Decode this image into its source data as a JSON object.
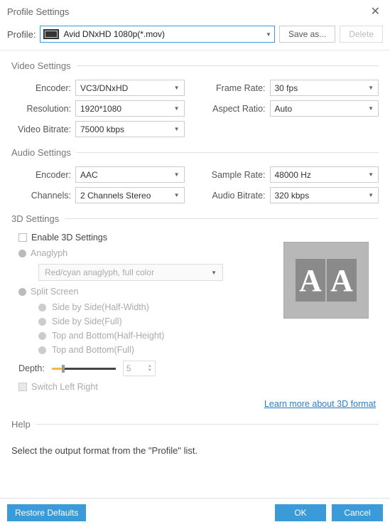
{
  "window": {
    "title": "Profile Settings"
  },
  "profile": {
    "label": "Profile:",
    "value": "Avid DNxHD 1080p(*.mov)",
    "save_as": "Save as...",
    "delete": "Delete"
  },
  "video_settings": {
    "title": "Video Settings",
    "encoder_label": "Encoder:",
    "encoder": "VC3/DNxHD",
    "resolution_label": "Resolution:",
    "resolution": "1920*1080",
    "bitrate_label": "Video Bitrate:",
    "bitrate": "75000 kbps",
    "frame_rate_label": "Frame Rate:",
    "frame_rate": "30 fps",
    "aspect_label": "Aspect Ratio:",
    "aspect": "Auto"
  },
  "audio_settings": {
    "title": "Audio Settings",
    "encoder_label": "Encoder:",
    "encoder": "AAC",
    "channels_label": "Channels:",
    "channels": "2 Channels Stereo",
    "sample_rate_label": "Sample Rate:",
    "sample_rate": "48000 Hz",
    "bitrate_label": "Audio Bitrate:",
    "bitrate": "320 kbps"
  },
  "three_d": {
    "title": "3D Settings",
    "enable_label": "Enable 3D Settings",
    "anaglyph_label": "Anaglyph",
    "anaglyph_select": "Red/cyan anaglyph, full color",
    "split_label": "Split Screen",
    "opt_sbs_half": "Side by Side(Half-Width)",
    "opt_sbs_full": "Side by Side(Full)",
    "opt_tb_half": "Top and Bottom(Half-Height)",
    "opt_tb_full": "Top and Bottom(Full)",
    "depth_label": "Depth:",
    "depth_value": "5",
    "switch_label": "Switch Left Right",
    "learn_more": "Learn more about 3D format"
  },
  "help": {
    "title": "Help",
    "text": "Select the output format from the \"Profile\" list."
  },
  "footer": {
    "restore": "Restore Defaults",
    "ok": "OK",
    "cancel": "Cancel"
  }
}
